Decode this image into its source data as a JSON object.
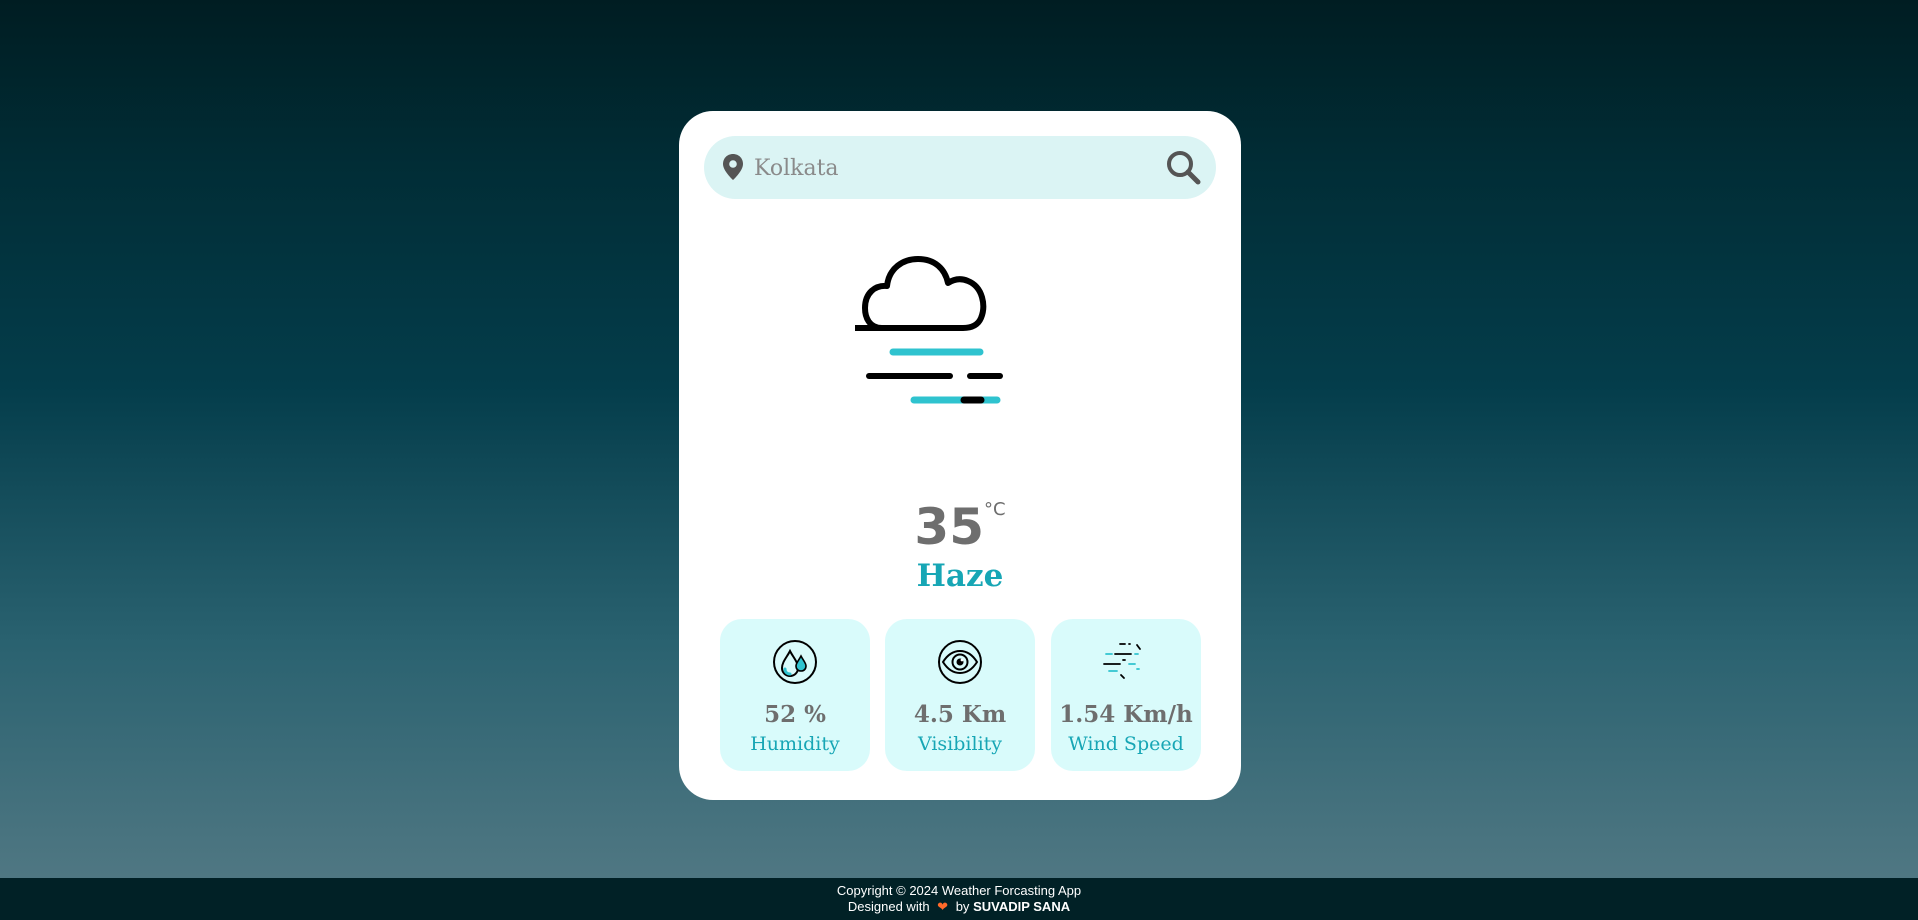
{
  "search": {
    "value": "",
    "placeholder": "Kolkata"
  },
  "weather": {
    "icon": "haze-icon",
    "temperature": "35",
    "unit": "°C",
    "condition": "Haze"
  },
  "stats": [
    {
      "icon": "humidity-icon",
      "value": "52 %",
      "label": "Humidity"
    },
    {
      "icon": "visibility-icon",
      "value": "4.5 Km",
      "label": "Visibility"
    },
    {
      "icon": "wind-icon",
      "value": "1.54 Km/h",
      "label": "Wind Speed"
    }
  ],
  "footer": {
    "copyright": "Copyright © 2024 Weather Forcasting App",
    "designed_with": "Designed with",
    "by": "by",
    "author": "SUVADIP SANA",
    "heart_icon": "heart-icon"
  },
  "colors": {
    "accent": "#17a6b5",
    "haze_line": "#2fc3cf",
    "card_bg": "#ffffff",
    "search_bg": "#dbf4f4",
    "stat_bg": "#d9fbfb",
    "footer_bg": "#012126",
    "heart": "#ff6a2a"
  }
}
